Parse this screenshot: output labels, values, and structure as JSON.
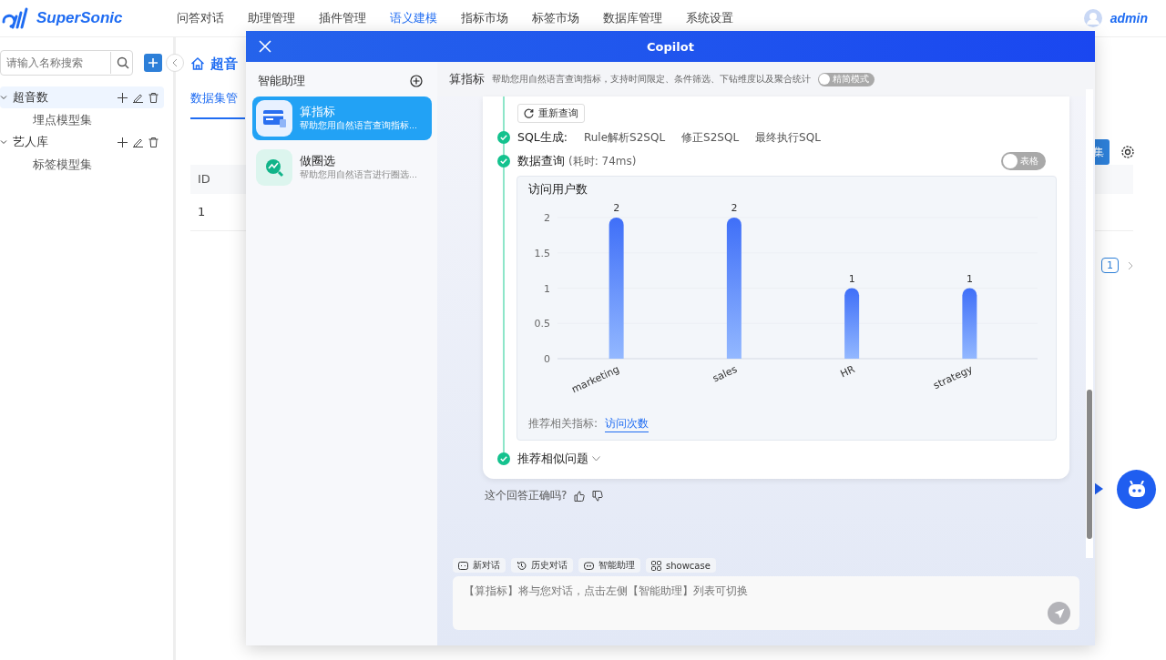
{
  "app": {
    "brand": "SuperSonic",
    "nav": [
      {
        "label": "问答对话",
        "selected": false
      },
      {
        "label": "助理管理",
        "selected": false
      },
      {
        "label": "插件管理",
        "selected": false
      },
      {
        "label": "语义建模",
        "selected": true
      },
      {
        "label": "指标市场",
        "selected": false
      },
      {
        "label": "标签市场",
        "selected": false
      },
      {
        "label": "数据库管理",
        "selected": false
      },
      {
        "label": "系统设置",
        "selected": false
      }
    ],
    "user": "admin"
  },
  "sidebar": {
    "search_placeholder": "请输入名称搜索",
    "tree": [
      {
        "label": "超音数",
        "selected": true,
        "expanded": true,
        "children": [
          {
            "label": "埋点模型集"
          }
        ]
      },
      {
        "label": "艺人库",
        "selected": false,
        "expanded": true,
        "children": [
          {
            "label": "标签模型集"
          }
        ]
      }
    ]
  },
  "main": {
    "breadcrumb": "超音",
    "tab": "数据集管",
    "button": "集",
    "table": {
      "columns": [
        "ID"
      ],
      "rows": [
        [
          "1"
        ]
      ]
    },
    "page": "1"
  },
  "copilot": {
    "title": "Copilot",
    "assistants_title": "智能助理",
    "assistants": [
      {
        "name": "算指标",
        "desc": "帮助您用自然语言查询指标...",
        "kind": "metric",
        "selected": true
      },
      {
        "name": "做圈选",
        "desc": "帮助您用自然语言进行圈选...",
        "kind": "select",
        "selected": false
      }
    ],
    "header": {
      "name": "算指标",
      "desc": "帮助您用自然语言查询指标，支持时间限定、条件筛选、下钻维度以及聚合统计",
      "mode_toggle": {
        "label": "精简模式",
        "on": false
      }
    },
    "message": {
      "retry": "重新查询",
      "sql_step": {
        "label": "SQL生成:",
        "links": [
          "Rule解析S2SQL",
          "修正S2SQL",
          "最终执行SQL"
        ]
      },
      "query_step": {
        "label": "数据查询",
        "time": "(耗时: 74ms)",
        "table_toggle": {
          "label": "表格",
          "on": false
        }
      },
      "chart_data": {
        "type": "bar",
        "title": "访问用户数",
        "categories": [
          "marketing",
          "sales",
          "HR",
          "strategy"
        ],
        "values": [
          2,
          2,
          1,
          1
        ],
        "ylim": [
          0,
          2
        ],
        "yticks": [
          0,
          0.5,
          1,
          1.5,
          2
        ],
        "data_labels": true
      },
      "related_label": "推荐相关指标:",
      "related_link": "访问次数",
      "similar": "推荐相似问题"
    },
    "feedback": "这个回答正确吗?",
    "tools": [
      {
        "label": "新对话",
        "kind": "chat"
      },
      {
        "label": "历史对话",
        "kind": "history"
      },
      {
        "label": "智能助理",
        "kind": "bot"
      },
      {
        "label": "showcase",
        "kind": "grid"
      }
    ],
    "input_placeholder": "【算指标】将与您对话，点击左侧【智能助理】列表可切换"
  }
}
